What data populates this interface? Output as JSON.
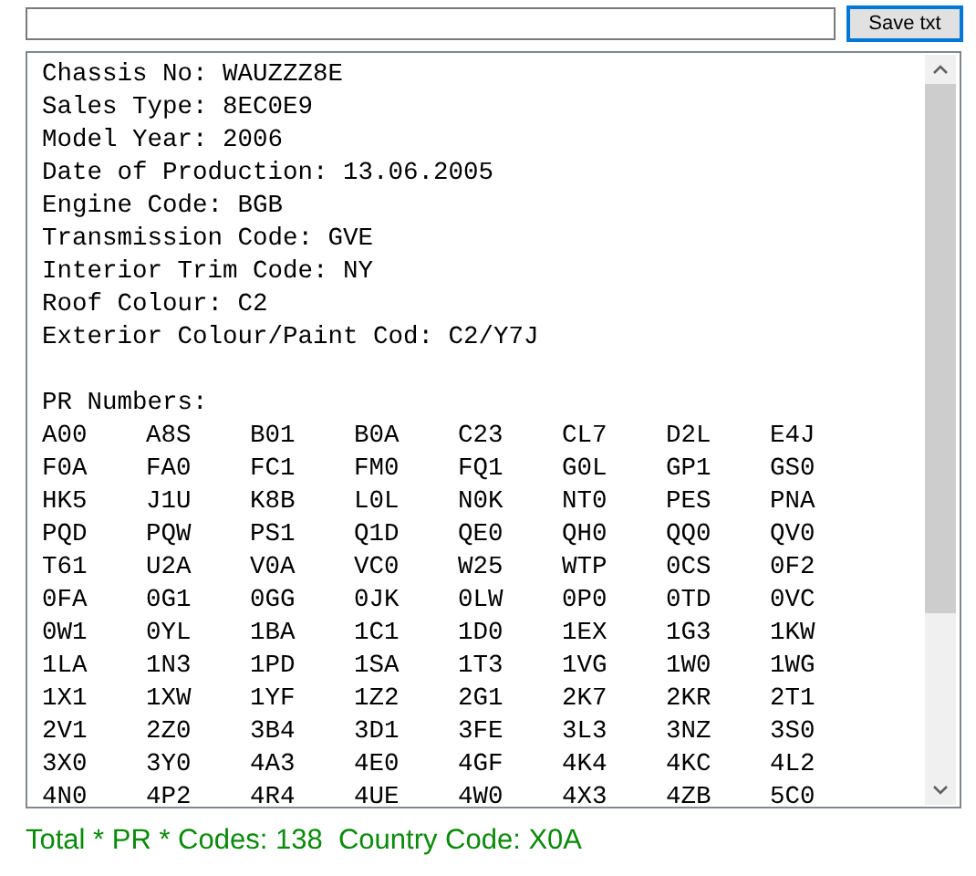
{
  "save_button": {
    "label": "Save txt"
  },
  "report": {
    "lines": [
      "Chassis No: WAUZZZ8E",
      "Sales Type: 8EC0E9",
      "Model Year: 2006",
      "Date of Production: 13.06.2005",
      "Engine Code: BGB",
      "Transmission Code: GVE",
      "Interior Trim Code: NY",
      "Roof Colour: C2",
      "Exterior Colour/Paint Cod: C2/Y7J"
    ],
    "pr_heading": "PR Numbers:",
    "pr_rows": [
      [
        "A00",
        "A8S",
        "B01",
        "B0A",
        "C23",
        "CL7",
        "D2L",
        "E4J"
      ],
      [
        "F0A",
        "FA0",
        "FC1",
        "FM0",
        "FQ1",
        "G0L",
        "GP1",
        "GS0"
      ],
      [
        "HK5",
        "J1U",
        "K8B",
        "L0L",
        "N0K",
        "NT0",
        "PES",
        "PNA"
      ],
      [
        "PQD",
        "PQW",
        "PS1",
        "Q1D",
        "QE0",
        "QH0",
        "QQ0",
        "QV0"
      ],
      [
        "T61",
        "U2A",
        "V0A",
        "VC0",
        "W25",
        "WTP",
        "0CS",
        "0F2"
      ],
      [
        "0FA",
        "0G1",
        "0GG",
        "0JK",
        "0LW",
        "0P0",
        "0TD",
        "0VC"
      ],
      [
        "0W1",
        "0YL",
        "1BA",
        "1C1",
        "1D0",
        "1EX",
        "1G3",
        "1KW"
      ],
      [
        "1LA",
        "1N3",
        "1PD",
        "1SA",
        "1T3",
        "1VG",
        "1W0",
        "1WG"
      ],
      [
        "1X1",
        "1XW",
        "1YF",
        "1Z2",
        "2G1",
        "2K7",
        "2KR",
        "2T1"
      ],
      [
        "2V1",
        "2Z0",
        "3B4",
        "3D1",
        "3FE",
        "3L3",
        "3NZ",
        "3S0"
      ],
      [
        "3X0",
        "3Y0",
        "4A3",
        "4E0",
        "4GF",
        "4K4",
        "4KC",
        "4L2"
      ],
      [
        "4N0",
        "4P2",
        "4R4",
        "4UE",
        "4W0",
        "4X3",
        "4ZB",
        "5C0"
      ]
    ]
  },
  "status": "Total * PR * Codes: 138  Country Code: X0A"
}
